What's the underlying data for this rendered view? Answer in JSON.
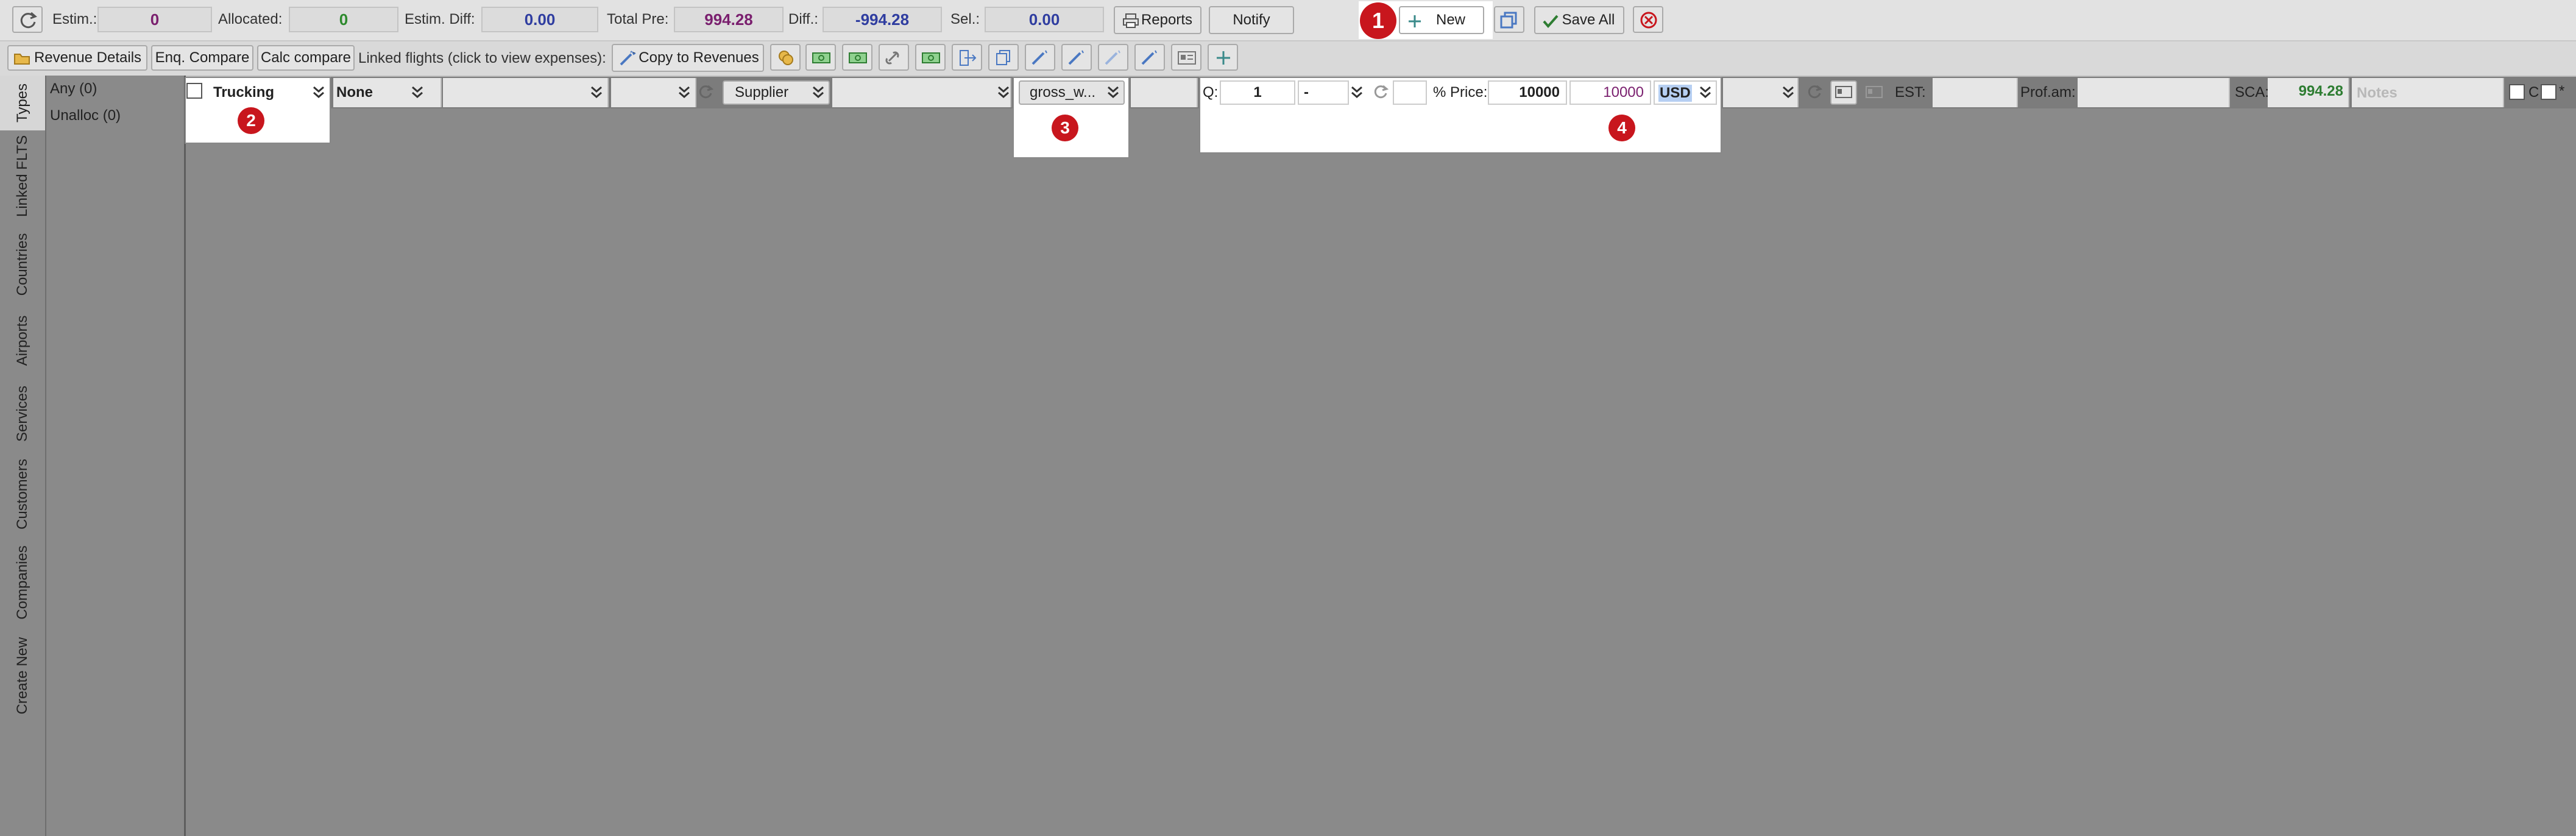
{
  "colors": {
    "purple": "#7a1f6e",
    "green": "#2d8a2d",
    "blue": "#2f3da0",
    "accent_green": "#2e7d32",
    "red_badge": "#c8161d",
    "link_blue": "#4a78c2"
  },
  "toolbar1": {
    "estim_label": "Estim.:",
    "estim_value": "0",
    "allocated_label": "Allocated:",
    "allocated_value": "0",
    "estim_diff_label": "Estim. Diff:",
    "estim_diff_value": "0.00",
    "total_pre_label": "Total Pre:",
    "total_pre_value": "994.28",
    "diff_label": "Diff.:",
    "diff_value": "-994.28",
    "sel_label": "Sel.:",
    "sel_value": "0.00",
    "reports_label": "Reports",
    "notify_label": "Notify",
    "new_label": "New",
    "save_all_label": "Save All"
  },
  "toolbar2": {
    "revenue_details": "Revenue Details",
    "enq_compare": "Enq. Compare",
    "calc_compare": "Calc compare",
    "linked_flights": "Linked flights (click to view expenses):",
    "copy_to_revenues": "Copy to Revenues"
  },
  "side_tabs": [
    "Types",
    "Linked FLTS",
    "Countries",
    "Airports",
    "Services",
    "Customers",
    "Companies",
    "Create New"
  ],
  "filters": [
    "Any (0)",
    "Unalloc (0)"
  ],
  "row": {
    "service": "Trucking",
    "none": "None",
    "supplier": "Supplier",
    "gross": "gross_w...",
    "q_label": "Q:",
    "q_value": "1",
    "dash": "-",
    "price_label": "% Price:",
    "price": "10000",
    "total": "10000",
    "currency": "USD",
    "est_label": "EST:",
    "prof_label": "Prof.am:",
    "sca_label": "SCA:",
    "sca_value": "994.28",
    "notes_placeholder": "Notes",
    "c_label": "C"
  },
  "badges": [
    "1",
    "2",
    "3",
    "4"
  ]
}
